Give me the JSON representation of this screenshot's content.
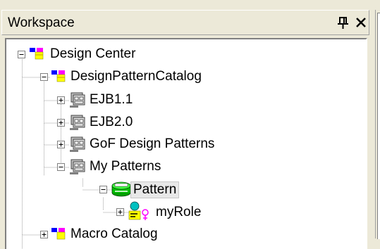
{
  "panel": {
    "title": "Workspace",
    "pin_glyph": "ⱺ",
    "close_glyph": "✕"
  },
  "tree": {
    "design_center": {
      "label": "Design Center",
      "icon": "catalog-folder-icon",
      "expander": "-"
    },
    "design_pattern_catalog": {
      "label": "DesignPatternCatalog",
      "icon": "catalog-folder-icon",
      "expander": "-"
    },
    "ejb11": {
      "label": "EJB1.1",
      "icon": "pattern-group-icon",
      "expander": "+"
    },
    "ejb20": {
      "label": "EJB2.0",
      "icon": "pattern-group-icon",
      "expander": "+"
    },
    "gof": {
      "label": "GoF Design Patterns",
      "icon": "pattern-group-icon",
      "expander": "+"
    },
    "my_patterns": {
      "label": "My Patterns",
      "icon": "pattern-group-icon",
      "expander": "-"
    },
    "pattern": {
      "label": "Pattern",
      "icon": "pattern-cylinder-icon",
      "expander": "-",
      "selected": true
    },
    "my_role": {
      "label": "myRole",
      "icon": "role-icon",
      "expander": "+"
    },
    "macro_catalog": {
      "label": "Macro Catalog",
      "icon": "catalog-folder-icon",
      "expander": "+"
    }
  },
  "colors": {
    "panel_bg": "#ece9d8",
    "tree_bg": "#ffffff",
    "selection_bg": "#e8e8e8",
    "dotted_line": "#a0a0a0"
  }
}
